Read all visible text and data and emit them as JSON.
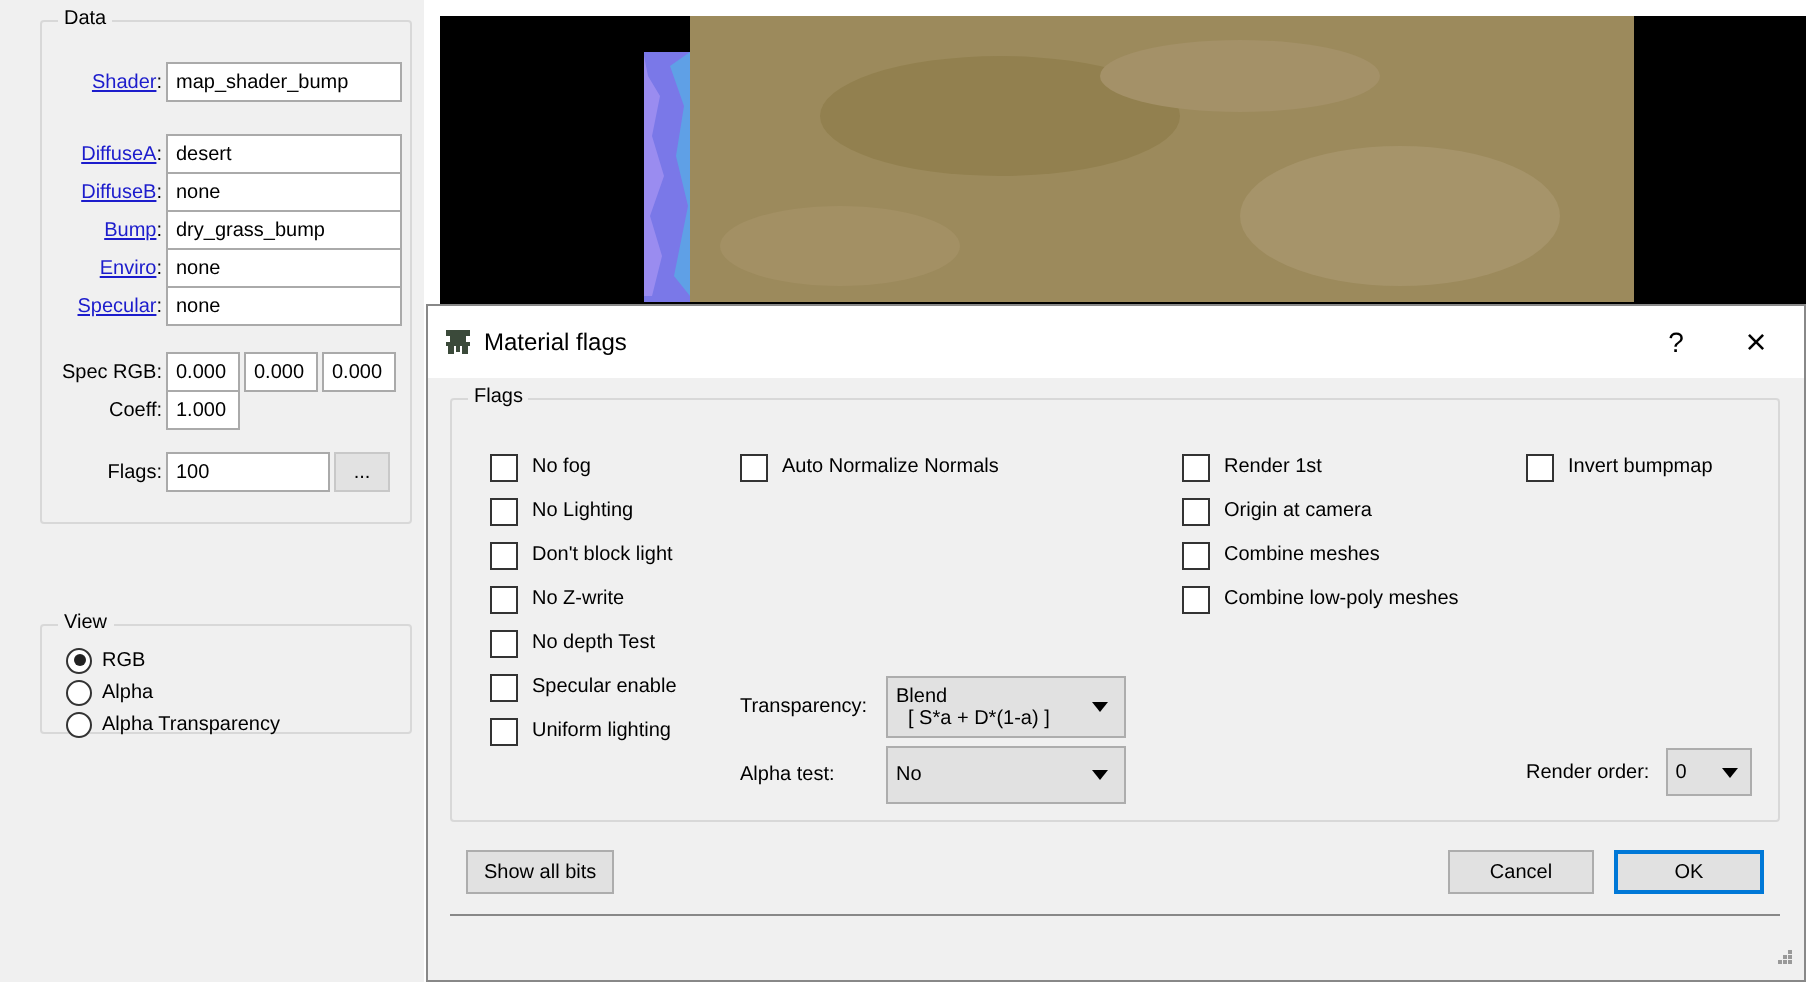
{
  "data_panel": {
    "title": "Data",
    "shader": {
      "label": "Shader",
      "colon": ":",
      "value": "map_shader_bump"
    },
    "textures": [
      {
        "label": "DiffuseA",
        "colon": ":",
        "value": "desert"
      },
      {
        "label": "DiffuseB",
        "colon": ":",
        "value": "none"
      },
      {
        "label": "Bump",
        "colon": ":",
        "value": "dry_grass_bump"
      },
      {
        "label": "Enviro",
        "colon": ":",
        "value": "none"
      },
      {
        "label": "Specular",
        "colon": ":",
        "value": "none"
      }
    ],
    "spec_rgb": {
      "label": "Spec RGB:",
      "values": [
        "0.000",
        "0.000",
        "0.000"
      ]
    },
    "coeff": {
      "label": "Coeff:",
      "value": "1.000"
    },
    "flags": {
      "label": "Flags:",
      "value": "100",
      "button": "..."
    }
  },
  "view": {
    "title": "View",
    "options": [
      {
        "label": "RGB",
        "selected": true
      },
      {
        "label": "Alpha",
        "selected": false
      },
      {
        "label": "Alpha Transparency",
        "selected": false
      }
    ]
  },
  "dialog": {
    "title": "Material flags",
    "help": "?",
    "close": "×",
    "group_title": "Flags",
    "column_1": [
      {
        "label": "No fog",
        "checked": false
      },
      {
        "label": "No Lighting",
        "checked": false
      },
      {
        "label": "Don't block light",
        "checked": false
      },
      {
        "label": "No Z-write",
        "checked": false
      },
      {
        "label": "No depth Test",
        "checked": false
      },
      {
        "label": "Specular enable",
        "checked": false
      },
      {
        "label": "Uniform lighting",
        "checked": false
      }
    ],
    "column_2": [
      {
        "label": "Auto Normalize Normals",
        "checked": false
      }
    ],
    "column_3": [
      {
        "label": "Render 1st",
        "checked": false
      },
      {
        "label": "Origin at camera",
        "checked": false
      },
      {
        "label": "Combine meshes",
        "checked": false
      },
      {
        "label": "Combine low-poly meshes",
        "checked": false
      }
    ],
    "column_4": [
      {
        "label": "Invert bumpmap",
        "checked": false
      }
    ],
    "transparency": {
      "label": "Transparency:",
      "value_lines": [
        "Blend",
        "[ S*a + D*(1-a) ]"
      ]
    },
    "alpha_test": {
      "label": "Alpha test:",
      "value": "No"
    },
    "render_order": {
      "label": "Render order:",
      "value": "0"
    },
    "buttons": [
      {
        "label": "Show all bits",
        "default": false
      },
      {
        "label": "Cancel",
        "default": false
      },
      {
        "label": "OK",
        "default": true
      }
    ]
  }
}
